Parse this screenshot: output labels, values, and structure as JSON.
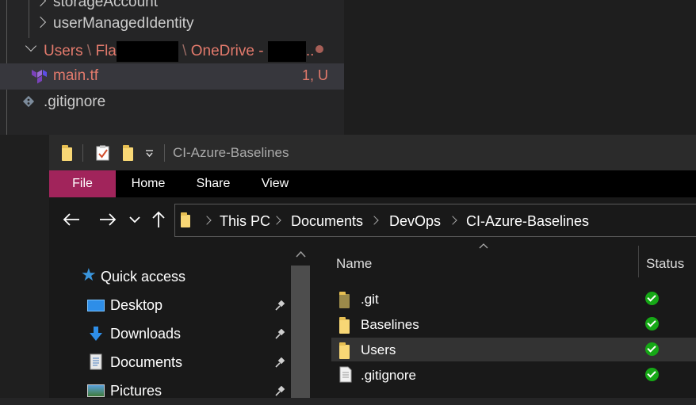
{
  "vscode": {
    "tree": [
      {
        "label": "storageAccount"
      },
      {
        "label": "userManagedIdentity"
      }
    ],
    "users_folder": {
      "part1": "Users",
      "part2": "Fla",
      "part3": "OneDrive -",
      "part4": ".."
    },
    "main_file": {
      "name": "main.tf",
      "badge": "1, U"
    },
    "gitignore": {
      "name": ".gitignore"
    }
  },
  "explorer": {
    "title": "CI-Azure-Baselines",
    "ribbon_tabs": [
      "File",
      "Home",
      "Share",
      "View"
    ],
    "breadcrumb": [
      "This PC",
      "Documents",
      "DevOps",
      "CI-Azure-Baselines"
    ],
    "nav": [
      {
        "label": "Quick access",
        "icon": "star-icon"
      },
      {
        "label": "Desktop",
        "icon": "desktop-icon",
        "pinned": true
      },
      {
        "label": "Downloads",
        "icon": "download-icon",
        "pinned": true
      },
      {
        "label": "Documents",
        "icon": "document-icon",
        "pinned": true
      },
      {
        "label": "Pictures",
        "icon": "pictures-icon",
        "pinned": true
      }
    ],
    "columns": {
      "name": "Name",
      "status": "Status"
    },
    "files": [
      {
        "name": ".git",
        "type": "folder-hidden",
        "status": "synced"
      },
      {
        "name": "Baselines",
        "type": "folder",
        "status": "synced"
      },
      {
        "name": "Users",
        "type": "folder",
        "status": "synced",
        "selected": true
      },
      {
        "name": ".gitignore",
        "type": "file",
        "status": "synced"
      }
    ],
    "colors": {
      "file_tab": "#a1245b",
      "check": "#16a816",
      "accent_red": "#e37a6c"
    }
  }
}
